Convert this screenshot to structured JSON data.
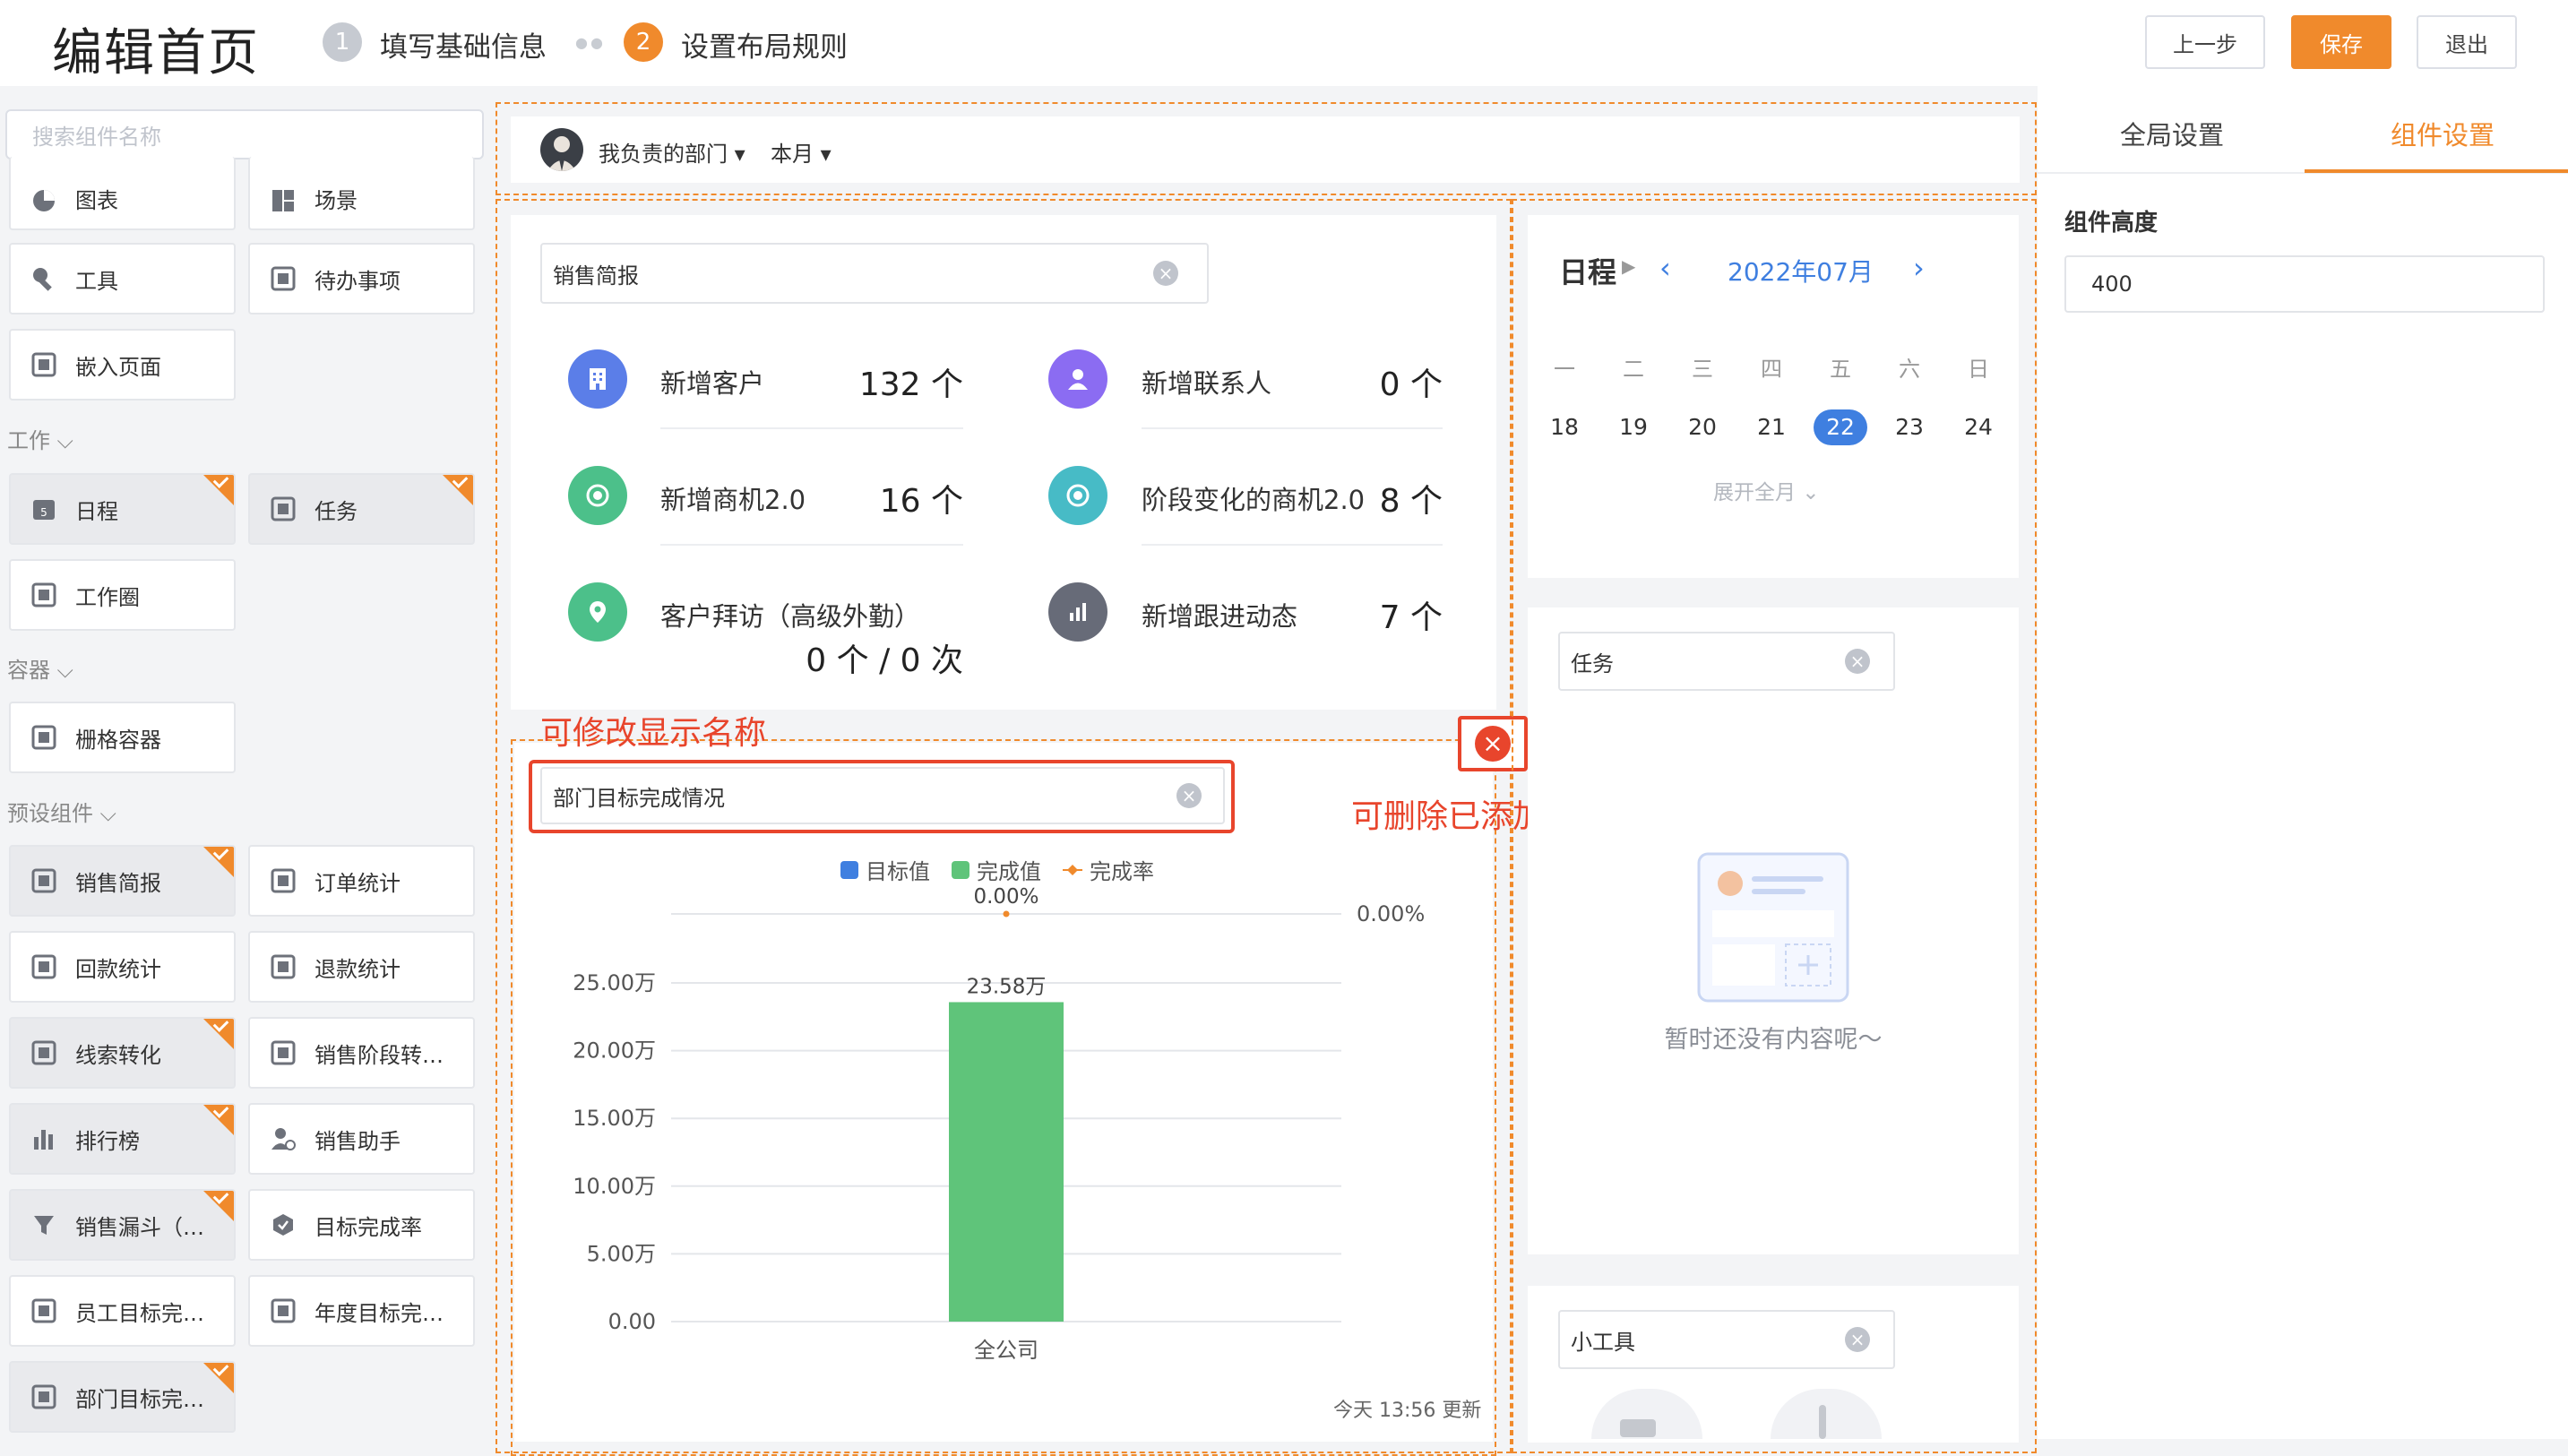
{
  "header": {
    "title": "编辑首页",
    "steps": [
      {
        "num": "1",
        "label": "填写基础信息"
      },
      {
        "num": "2",
        "label": "设置布局规则"
      }
    ],
    "prev_label": "上一步",
    "save_label": "保存",
    "exit_label": "退出"
  },
  "sidebar": {
    "search_placeholder": "搜索组件名称",
    "groups": {
      "work": "工作",
      "container": "容器",
      "preset": "预设组件"
    },
    "items": {
      "chart": "图表",
      "scene": "场景",
      "tool": "工具",
      "todo": "待办事项",
      "embed": "嵌入页面",
      "schedule": "日程",
      "task": "任务",
      "workcircle": "工作圈",
      "grid": "栅格容器",
      "sales_brief": "销售简报",
      "order_stats": "订单统计",
      "payment_stats": "回款统计",
      "refund_stats": "退款统计",
      "lead_conv": "线索转化",
      "stage_conv": "销售阶段转…",
      "ranking": "排行榜",
      "assistant": "销售助手",
      "funnel": "销售漏斗（…",
      "goal_rate": "目标完成率",
      "emp_goal": "员工目标完…",
      "year_goal": "年度目标完…",
      "dept_goal": "部门目标完…"
    }
  },
  "filter": {
    "dept": "我负责的部门",
    "period": "本月"
  },
  "sales_brief": {
    "name": "销售简报",
    "stats": [
      {
        "label": "新增客户",
        "value": "132 个",
        "color": "#5b7ee8",
        "icon": "building-icon"
      },
      {
        "label": "新增联系人",
        "value": "0 个",
        "color": "#8b6cf2",
        "icon": "person-icon"
      },
      {
        "label": "新增商机2.0",
        "value": "16 个",
        "color": "#4cc08a",
        "icon": "target-icon"
      },
      {
        "label": "阶段变化的商机2.0",
        "value": "8 个",
        "color": "#47bbc6",
        "icon": "target-icon"
      },
      {
        "label": "客户拜访（高级外勤）",
        "value": "0 个 / 0 次",
        "color": "#4cc08a",
        "icon": "location-icon"
      },
      {
        "label": "新增跟进动态",
        "value": "7 个",
        "color": "#676b78",
        "icon": "bar-chart-icon"
      }
    ]
  },
  "annotations": {
    "rename": "可修改显示名称",
    "delete": "可删除已添加的组件"
  },
  "dept_goal": {
    "name": "部门目标完成情况",
    "updated": "今天 13:56 更新"
  },
  "chart_data": {
    "type": "bar",
    "categories": [
      "全公司"
    ],
    "series": [
      {
        "name": "目标值",
        "values": [
          0
        ],
        "color": "#3f7fe0"
      },
      {
        "name": "完成值",
        "values": [
          235800
        ],
        "color": "#5fc47a"
      },
      {
        "name": "完成率",
        "values": [
          0
        ],
        "color": "#f08a2c"
      }
    ],
    "y_ticks": [
      "0.00",
      "5.00万",
      "10.00万",
      "15.00万",
      "20.00万",
      "25.00万"
    ],
    "ylim": [
      0,
      250000
    ],
    "y2_tick": "0.00%",
    "bar_label": "23.58万",
    "rate_label": "0.00%"
  },
  "calendar": {
    "title": "日程",
    "month": "2022年07月",
    "weekdays": [
      "一",
      "二",
      "三",
      "四",
      "五",
      "六",
      "日"
    ],
    "days": [
      "18",
      "19",
      "20",
      "21",
      "22",
      "23",
      "24"
    ],
    "today": "22",
    "expand": "展开全月"
  },
  "task": {
    "name": "任务",
    "empty": "暂时还没有内容呢～"
  },
  "tools": {
    "name": "小工具"
  },
  "right_panel": {
    "tabs": [
      "全局设置",
      "组件设置"
    ],
    "active_tab": "组件设置",
    "height_label": "组件高度",
    "height_value": "400"
  },
  "colors": {
    "accent": "#f08a2c",
    "blue": "#3f7fe0",
    "red": "#e8452c"
  }
}
